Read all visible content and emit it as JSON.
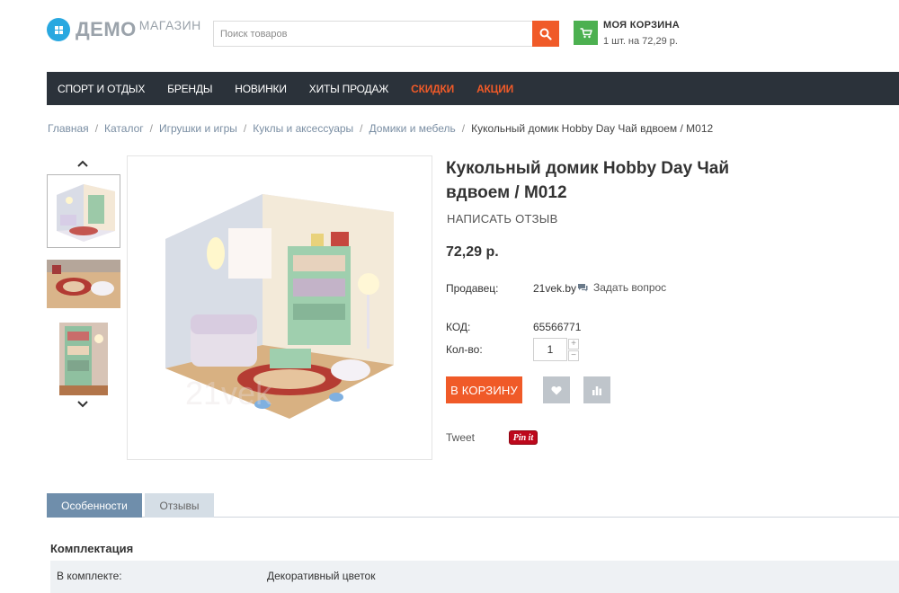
{
  "header": {
    "logo_main": "ДЕМО",
    "logo_sub": "МАГАЗИН",
    "search_placeholder": "Поиск товаров",
    "cart_title": "МОЯ КОРЗИНА",
    "cart_summary": "1 шт. на 72,29 р."
  },
  "nav": {
    "items": [
      {
        "label": "СПОРТ И ОТДЫХ"
      },
      {
        "label": "БРЕНДЫ"
      },
      {
        "label": "НОВИНКИ"
      },
      {
        "label": "ХИТЫ ПРОДАЖ"
      },
      {
        "label": "СКИДКИ"
      },
      {
        "label": "АКЦИИ"
      }
    ]
  },
  "breadcrumb": [
    "Главная",
    "Каталог",
    "Игрушки и игры",
    "Куклы и аксессуары",
    "Домики и мебель",
    "Кукольный домик Hobby Day Чай вдвоем / M012"
  ],
  "product": {
    "title": "Кукольный домик Hobby Day Чай вдвоем / M012",
    "write_review": "НАПИСАТЬ ОТЗЫВ",
    "price": "72,29 р.",
    "seller_label": "Продавец:",
    "seller_value": "21vek.by",
    "ask_question": "Задать вопрос",
    "code_label": "КОД:",
    "code_value": "65566771",
    "qty_label": "Кол-во:",
    "qty_value": "1",
    "qty_plus": "+",
    "qty_minus": "−",
    "add_to_cart": "В КОРЗИНУ",
    "tweet": "Tweet",
    "pinit": "Pin it"
  },
  "tabs": [
    {
      "label": "Особенности"
    },
    {
      "label": "Отзывы"
    }
  ],
  "specs": {
    "section_title": "Комплектация",
    "rows": [
      {
        "key": "В комплекте:",
        "value": "Декоративный цветок"
      }
    ]
  },
  "colors": {
    "accent": "#f05a28",
    "nav_bg": "#2b323a",
    "cart_green": "#4cb050",
    "logo_blue": "#29a8e0",
    "tab_active": "#6f8eab",
    "tab_inactive": "#d5dee6"
  },
  "icons": {
    "search": "search-icon",
    "cart": "cart-icon",
    "chat": "chat-icon",
    "heart": "heart-icon",
    "compare": "compare-icon",
    "chevron_up": "chevron-up-icon",
    "chevron_down": "chevron-down-icon"
  }
}
